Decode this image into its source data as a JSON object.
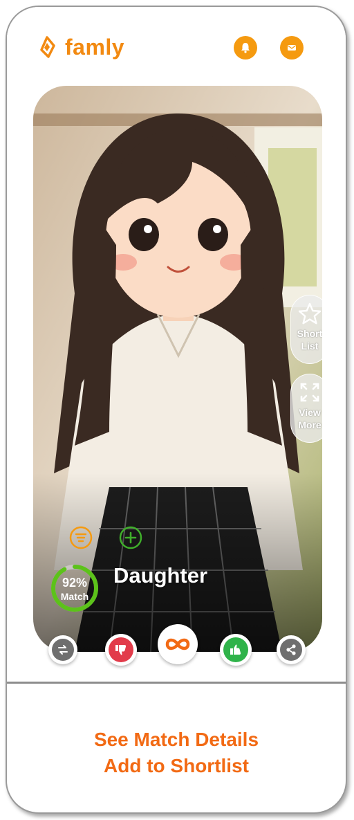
{
  "app": {
    "brand_name": "famly"
  },
  "header": {
    "notification_icon": "bell-icon",
    "message_icon": "mail-icon"
  },
  "profile": {
    "name": "Daughter",
    "match_percent": "92%",
    "match_label": "Match",
    "match_value": 0.92,
    "photo_icon": "profile-photo"
  },
  "side_actions": {
    "shortlist_label_1": "Short",
    "shortlist_label_2": "List",
    "view_more_label_1": "View",
    "view_more_label_2": "More"
  },
  "action_bar": {
    "icons": [
      "swap-icon",
      "dislike-icon",
      "infinity-icon",
      "like-icon",
      "share-icon"
    ]
  },
  "cta": {
    "line1": "See Match Details",
    "line2": "Add to Shortlist"
  },
  "colors": {
    "brand": "#f28a12",
    "cta": "#f26a14",
    "match_ring": "#5cc21a",
    "dislike": "#e23b4a",
    "like": "#2fb34a"
  }
}
